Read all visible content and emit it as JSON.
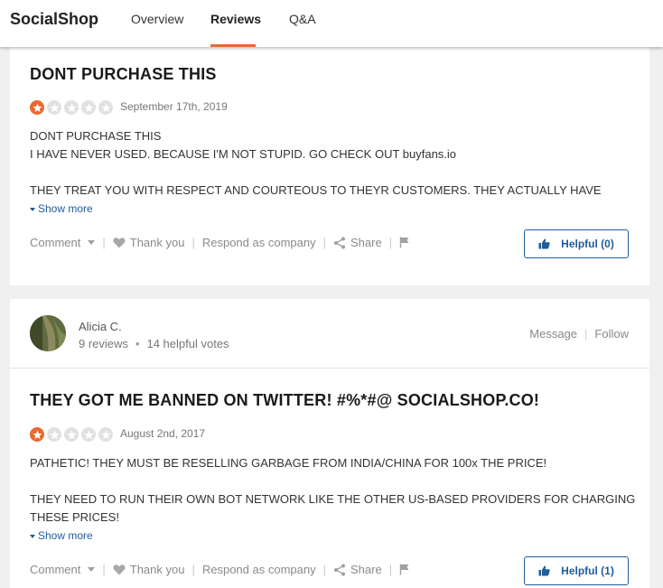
{
  "header": {
    "brand": "SocialShop",
    "tabs": [
      {
        "label": "Overview",
        "active": false
      },
      {
        "label": "Reviews",
        "active": true
      },
      {
        "label": "Q&A",
        "active": false
      }
    ],
    "accent_color": "#e86a30"
  },
  "reviews": [
    {
      "title": "DONT PURCHASE THIS",
      "rating": 1,
      "max_rating": 5,
      "date": "September 17th, 2019",
      "body": "DONT PURCHASE THIS\nI HAVE NEVER USED. BECAUSE I'M NOT STUPID. GO CHECK OUT buyfans.io\n\nTHEY TREAT YOU WITH RESPECT AND COURTEOUS TO THEYR CUSTOMERS. THEY ACTUALLY HAVE",
      "show_more": "Show more",
      "actions": {
        "comment": "Comment",
        "thank": "Thank you",
        "respond": "Respond as company",
        "share": "Share"
      },
      "helpful_label": "Helpful (0)"
    },
    {
      "user": {
        "name": "Alicia C.",
        "reviews": "9 reviews",
        "votes": "14 helpful votes",
        "message": "Message",
        "follow": "Follow"
      },
      "title": "THEY GOT ME BANNED ON TWITTER! #%*#@ SOCIALSHOP.CO!",
      "rating": 1,
      "max_rating": 5,
      "date": "August 2nd, 2017",
      "body": "PATHETIC! THEY MUST BE RESELLING GARBAGE FROM INDIA/CHINA FOR 100x THE PRICE!\n\nTHEY NEED TO RUN THEIR OWN BOT NETWORK LIKE THE OTHER US-BASED PROVIDERS FOR CHARGING THESE PRICES!",
      "show_more": "Show more",
      "actions": {
        "comment": "Comment",
        "thank": "Thank you",
        "respond": "Respond as company",
        "share": "Share"
      },
      "helpful_label": "Helpful (1)"
    }
  ],
  "icons": [
    "star-icon",
    "heart-icon",
    "share-icon",
    "flag-icon",
    "thumbs-up-icon",
    "chevron-down-icon"
  ]
}
